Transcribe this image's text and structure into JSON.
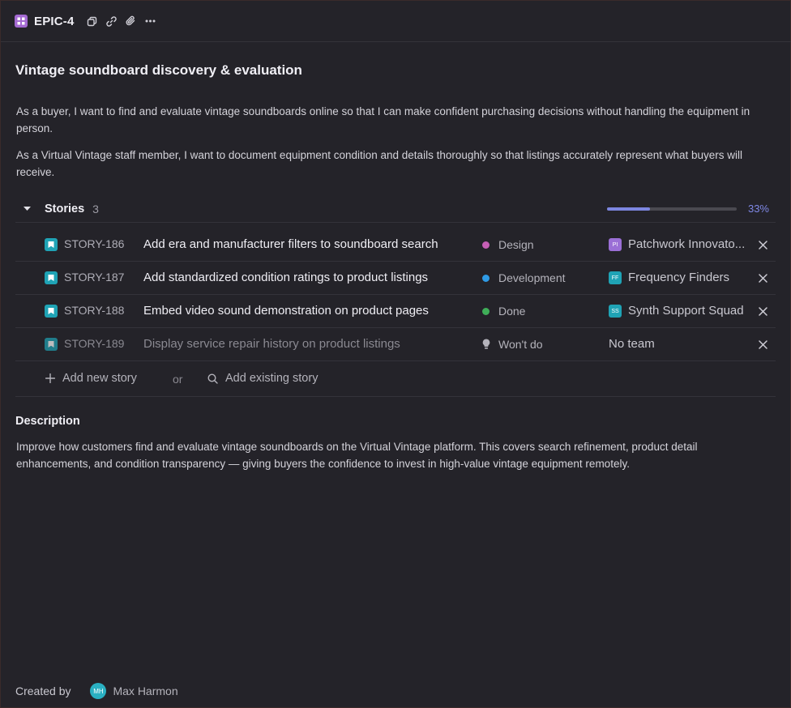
{
  "header": {
    "epic_key": "EPIC-4",
    "actions": [
      "copy-icon",
      "link-icon",
      "attachment-icon",
      "more-icon"
    ]
  },
  "title": "Vintage soundboard discovery & evaluation",
  "summary": [
    "As a buyer, I want to find and evaluate vintage soundboards online so that I can make confident purchasing decisions without handling the equipment in person.",
    "As a Virtual Vintage staff member, I want to document equipment condition and details thoroughly so that listings accurately represent what buyers will receive."
  ],
  "stories": {
    "label": "Stories",
    "count": "3",
    "progress_fraction": 0.33,
    "progress_label": "33%",
    "items": [
      {
        "key": "STORY-186",
        "title": "Add era and manufacturer filters to soundboard search",
        "status": "Design",
        "status_color": "#c65fb5",
        "team_initials": "PI",
        "team_color": "#9b6fd6",
        "team": "Patchwork Innovato..."
      },
      {
        "key": "STORY-187",
        "title": "Add standardized condition ratings to product listings",
        "status": "Development",
        "status_color": "#2f9be6",
        "team_initials": "FF",
        "team_color": "#1fa3b5",
        "team": "Frequency Finders"
      },
      {
        "key": "STORY-188",
        "title": "Embed video sound demonstration on product pages",
        "status": "Done",
        "status_color": "#3fae58",
        "team_initials": "SS",
        "team_color": "#1fa3b5",
        "team": "Synth Support Squad"
      },
      {
        "key": "STORY-189",
        "title": "Display service repair history on product listings",
        "status": "Won't do",
        "status_color": "#b4b3bb",
        "team_initials": "",
        "team_color": "",
        "team": "No team"
      }
    ],
    "add_new": "Add new story",
    "or": "or",
    "add_existing": "Add existing story"
  },
  "description": {
    "label": "Description",
    "text": "Improve how customers find and evaluate vintage soundboards on the Virtual Vintage platform. This covers search refinement, product detail enhancements, and condition transparency — giving buyers the confidence to invest in high-value vintage equipment remotely."
  },
  "footer": {
    "created_by_label": "Created by",
    "creator_initials": "MH",
    "creator_name": "Max Harmon"
  },
  "colors": {
    "background": "#242329",
    "accent": "#7d86e0",
    "epic": "#a46ad2",
    "story": "#1fa3b5"
  }
}
